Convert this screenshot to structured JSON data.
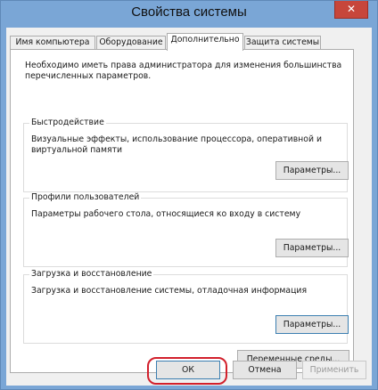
{
  "window": {
    "title": "Свойства системы",
    "close_glyph": "✕"
  },
  "tabs": [
    {
      "label": "Имя компьютера",
      "active": false
    },
    {
      "label": "Оборудование",
      "active": false
    },
    {
      "label": "Дополнительно",
      "active": true
    },
    {
      "label": "Защита системы",
      "active": false
    }
  ],
  "panel": {
    "intro": "Необходимо иметь права администратора для изменения большинства перечисленных параметров.",
    "performance": {
      "title": "Быстродействие",
      "desc": "Визуальные эффекты, использование процессора, оперативной и виртуальной памяти",
      "button": "Параметры..."
    },
    "profiles": {
      "title": "Профили пользователей",
      "desc": "Параметры рабочего стола, относящиеся ко входу в систему",
      "button": "Параметры..."
    },
    "startup": {
      "title": "Загрузка и восстановление",
      "desc": "Загрузка и восстановление системы, отладочная информация",
      "button": "Параметры..."
    },
    "env_button": "Переменные среды..."
  },
  "footer": {
    "ok": "ОК",
    "cancel": "Отмена",
    "apply": "Применить"
  },
  "colors": {
    "highlight": "#d2202c",
    "frame": "#7aa6d6",
    "close": "#c7463b"
  }
}
